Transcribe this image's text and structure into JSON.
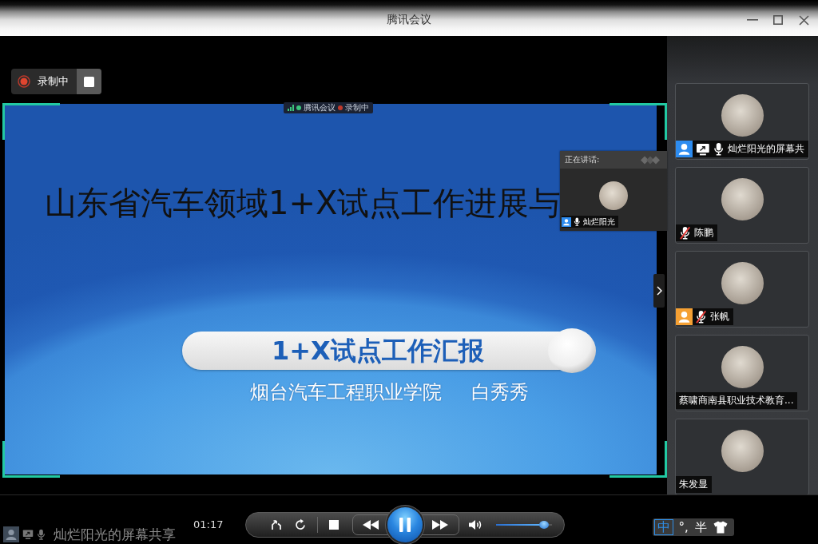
{
  "window": {
    "title": "腾讯会议"
  },
  "recording_badge": {
    "label": "录制中"
  },
  "shared_screen": {
    "status_strip": {
      "app": "腾讯会议",
      "recording": "录制中"
    },
    "slide": {
      "title": "山东省汽车领域1+X试点工作进展与",
      "banner": "1+X试点工作汇报",
      "institution": "烟台汽车工程职业学院",
      "presenter": "白秀秀"
    },
    "speaking_popup": {
      "header": "正在讲话:",
      "name": "灿烂阳光",
      "badge": {
        "color": "#2d8cf0"
      },
      "mic": {
        "muted": false
      }
    }
  },
  "participants": [
    {
      "name": "灿烂阳光的屏幕共",
      "badge": {
        "color": "#2d8cf0"
      },
      "sharing": true,
      "mic": {
        "muted": false
      }
    },
    {
      "name": "陈鹏",
      "sharing": false,
      "mic": {
        "muted": true
      }
    },
    {
      "name": "张帆",
      "badge": {
        "color": "#f5a033"
      },
      "sharing": false,
      "mic": {
        "muted": true
      }
    },
    {
      "name": "蔡啸商南县职业技术教育...",
      "sharing": false
    },
    {
      "name": "朱发显",
      "sharing": false
    }
  ],
  "footer": {
    "sharer": "灿烂阳光的屏幕共享",
    "time": "01:17"
  },
  "player": {
    "playing": true,
    "volume": {
      "level": 0.85
    }
  },
  "ime": {
    "mode": "中",
    "punctuation": "°,",
    "width": "半"
  }
}
